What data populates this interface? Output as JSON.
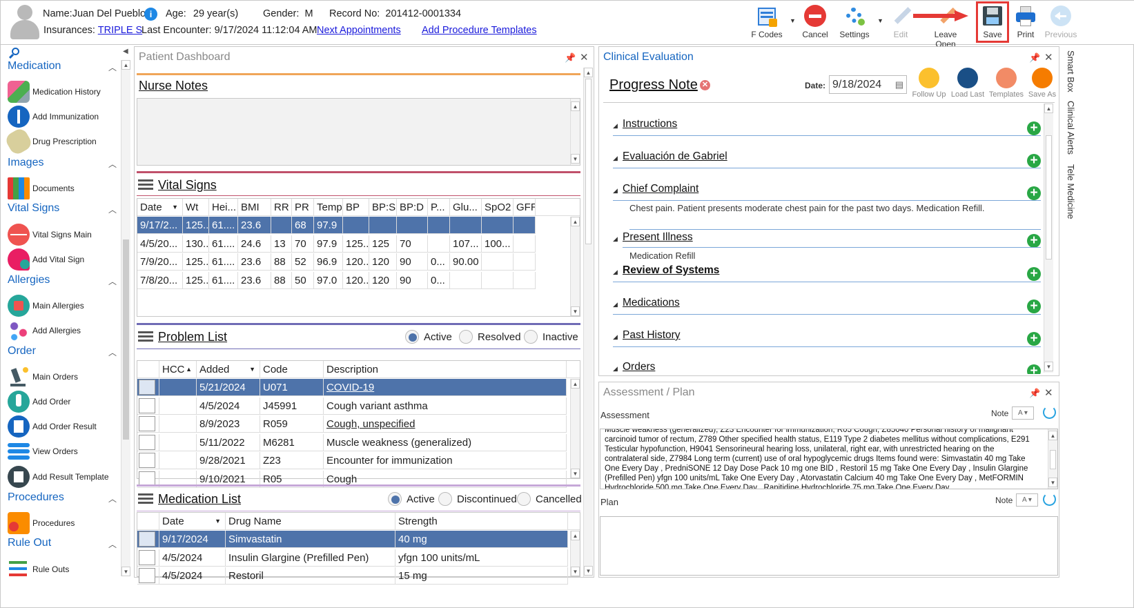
{
  "patient": {
    "name_label": "Name:",
    "name": "Juan Del Pueblo",
    "age_label": "Age:",
    "age": "29 year(s)",
    "gender_label": "Gender:",
    "gender": "M",
    "record_label": "Record No:",
    "record": "201412-0001334",
    "insurances_label": "Insurances:",
    "insurance": "TRIPLE S",
    "last_encounter_label": "Last Encounter:",
    "last_encounter": "9/17/2024 11:12:04 AM",
    "next_appointments": "Next Appointments",
    "add_procedure_templates": "Add Procedure Templates"
  },
  "toolbar": {
    "fcodes": "F Codes",
    "cancel": "Cancel",
    "settings": "Settings",
    "edit": "Edit",
    "leave_open": "Leave Open",
    "save": "Save",
    "print": "Print",
    "previous": "Previous"
  },
  "sidebar": {
    "medication": "Medication",
    "medication_history": "Medication History",
    "add_immunization": "Add Immunization",
    "drug_prescription": "Drug Prescription",
    "images": "Images",
    "documents": "Documents",
    "vital_signs": "Vital Signs",
    "vital_signs_main": "Vital Signs Main",
    "add_vital_sign": "Add Vital Sign",
    "allergies": "Allergies",
    "main_allergies": "Main Allergies",
    "add_allergies": "Add Allergies",
    "order": "Order",
    "main_orders": "Main Orders",
    "add_order": "Add Order",
    "add_order_result": "Add Order Result",
    "view_orders": "View Orders",
    "add_result_template": "Add Result Template",
    "procedures": "Procedures",
    "procedures_item": "Procedures",
    "rule_out": "Rule Out",
    "rule_outs": "Rule Outs"
  },
  "dashboard": {
    "title": "Patient Dashboard",
    "nurse_notes": "Nurse Notes",
    "vital_signs": "Vital Signs",
    "vitals_headers": [
      "Date",
      "Wt",
      "Hei...",
      "BMI",
      "RR",
      "PR",
      "Temp",
      "BP",
      "BP:S",
      "BP:D",
      "P...",
      "Glu...",
      "SpO2",
      "GFR"
    ],
    "vitals_rows": [
      [
        "9/17/2...",
        "125...",
        "61....",
        "23.6",
        "",
        "68",
        "97.9",
        "",
        "",
        "",
        "",
        "",
        "",
        ""
      ],
      [
        "4/5/20...",
        "130...",
        "61....",
        "24.6",
        "13",
        "70",
        "97.9",
        "125...",
        "125",
        "70",
        "",
        "107...",
        "100...",
        ""
      ],
      [
        "7/9/20...",
        "125...",
        "61....",
        "23.6",
        "88",
        "52",
        "96.9",
        "120...",
        "120",
        "90",
        "0...",
        "90.00",
        "",
        ""
      ],
      [
        "7/8/20...",
        "125...",
        "61....",
        "23.6",
        "88",
        "50",
        "97.0",
        "120...",
        "120",
        "90",
        "0...",
        "",
        "",
        ""
      ]
    ],
    "problem_list": "Problem List",
    "problem_filters": [
      "Active",
      "Resolved",
      "Inactive"
    ],
    "problem_headers": [
      "HCC",
      "Added",
      "Code",
      "Description"
    ],
    "problem_rows": [
      [
        "",
        "5/21/2024",
        "U071",
        "COVID-19"
      ],
      [
        "",
        "4/5/2024",
        "J45991",
        "Cough variant asthma"
      ],
      [
        "",
        "8/9/2023",
        "R059",
        "Cough, unspecified"
      ],
      [
        "",
        "5/11/2022",
        "M6281",
        "Muscle weakness (generalized)"
      ],
      [
        "",
        "9/28/2021",
        "Z23",
        "Encounter for immunization"
      ],
      [
        "",
        "9/10/2021",
        "R05",
        "Cough"
      ]
    ],
    "medication_list": "Medication List",
    "med_filters": [
      "Active",
      "Discontinued",
      "Cancelled"
    ],
    "med_headers": [
      "Date",
      "Drug Name",
      "Strength"
    ],
    "med_rows": [
      [
        "9/17/2024",
        "Simvastatin",
        "40 mg"
      ],
      [
        "4/5/2024",
        "Insulin Glargine (Prefilled Pen)",
        "yfgn 100 units/mL"
      ],
      [
        "4/5/2024",
        "Restoril",
        "15 mg"
      ]
    ]
  },
  "clinical": {
    "title": "Clinical Evaluation",
    "note_title": "Progress Note",
    "date_label": "Date:",
    "date_value": "9/18/2024",
    "actions": [
      "Follow Up",
      "Load Last",
      "Templates",
      "Save As"
    ],
    "sections": [
      "Instructions",
      "Evaluación de Gabriel",
      "Chief Complaint",
      "Present Illness",
      "Review of Systems",
      "Medications",
      "Past History",
      "Orders"
    ],
    "chief_complaint_text": "Chest pain. Patient presents moderate chest pain for the past two days. Medication Refill.",
    "present_illness_text": "Medication Refill"
  },
  "assessment": {
    "title": "Assessment / Plan",
    "assessment_label": "Assessment",
    "note_label": "Note",
    "assessment_text": "Muscle weakness (generalized), Z23 Encounter for immunization, R05 Cough, Z85040 Personal history of malignant carcinoid tumor of rectum, Z789 Other specified health status, E119 Type 2 diabetes mellitus without complications, E291 Testicular hypofunction, H9041 Sensorineural hearing loss, unilateral, right ear, with unrestricted hearing on the contralateral side, Z7984 Long term (current) use of oral hypoglycemic drugs  Items found were:  Simvastatin 40 mg Take One Every Day , PredniSONE 12 Day Dose Pack 10 mg one BID , Restoril 15 mg Take One Every Day , Insulin Glargine (Prefilled Pen) yfgn 100 units/mL Take One Every Day , Atorvastatin Calcium 40 mg Take One Every Day , MetFORMIN Hydrochloride 500 mg Take One Every Day , Ranitidine Hydrochloride 75 mg Take One Every Day",
    "plan_label": "Plan"
  },
  "right_tabs": [
    "Smart Box",
    "Clinical Alerts",
    "Tele Medicine"
  ]
}
